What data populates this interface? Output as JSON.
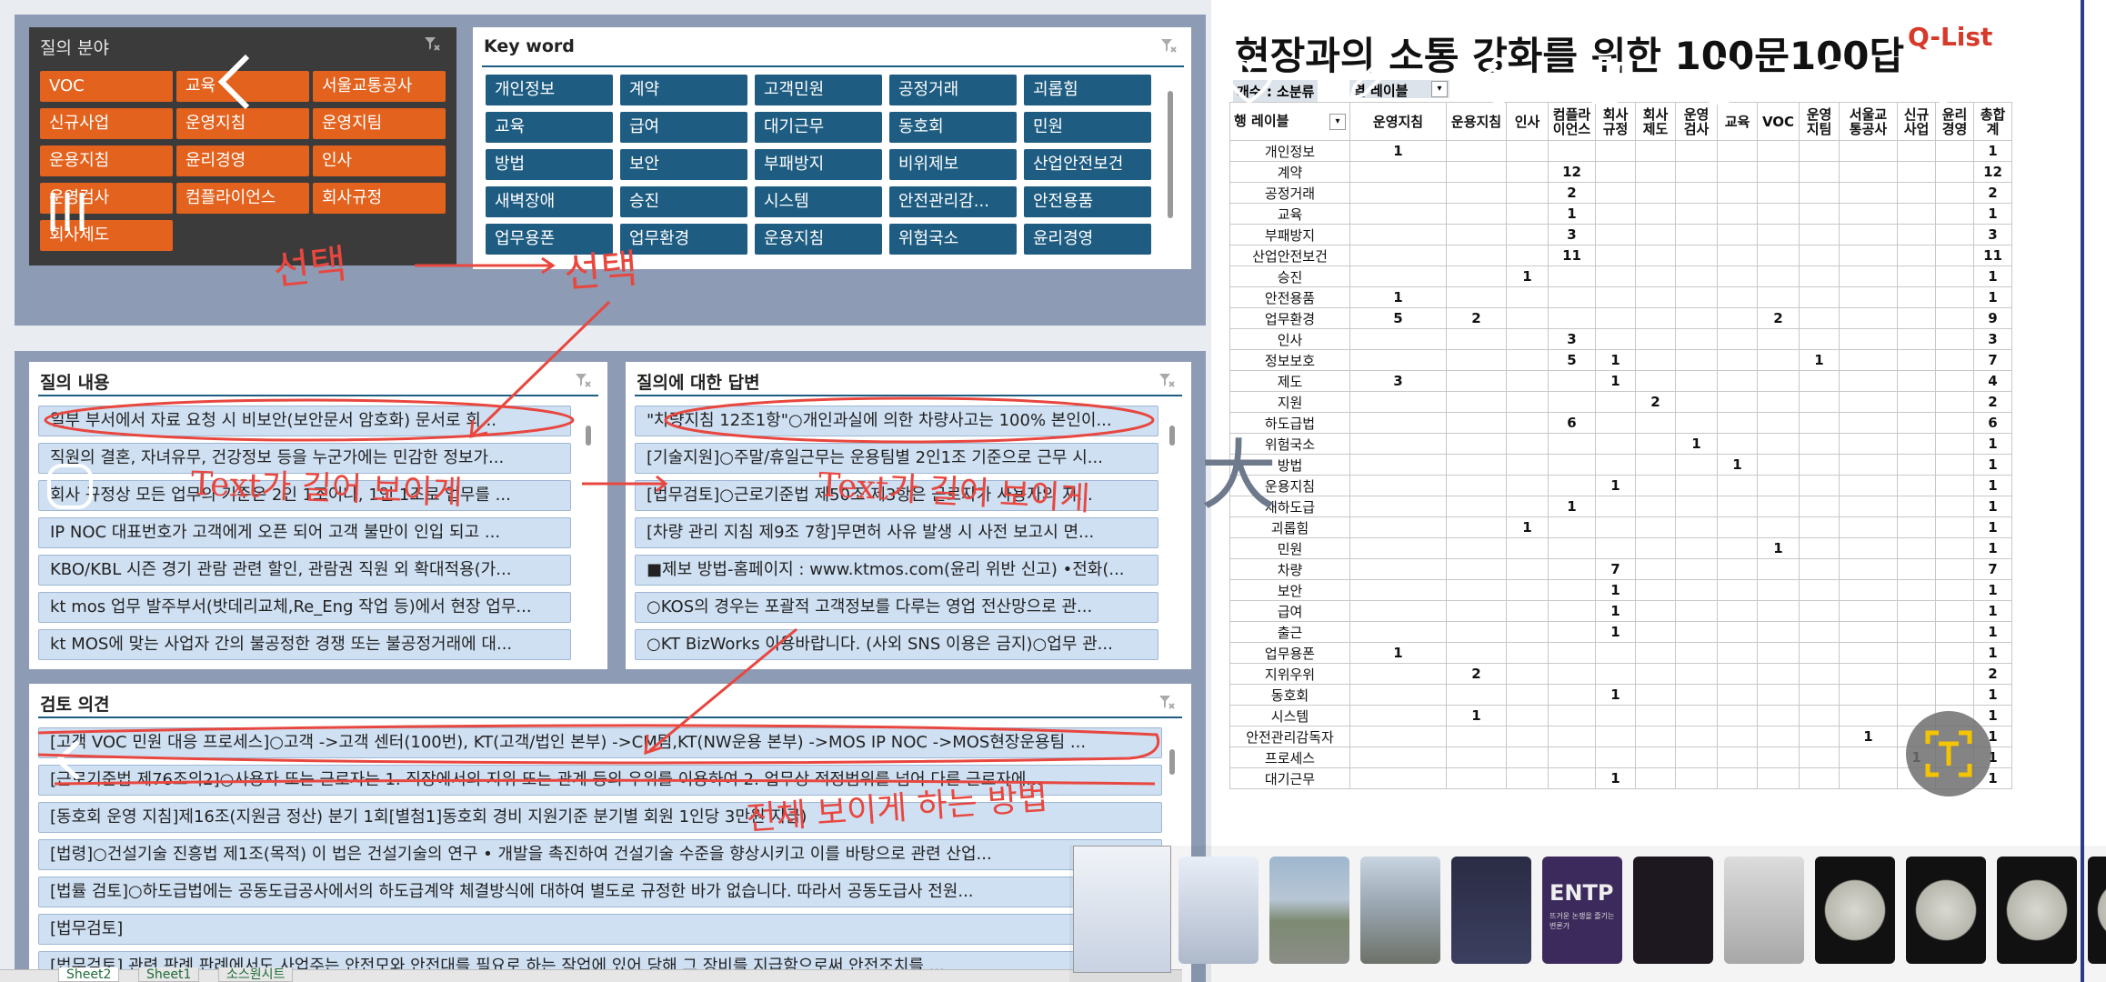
{
  "field_panel": {
    "title": "질의 분야",
    "items": [
      "VOC",
      "교육",
      "서울교통공사",
      "신규사업",
      "운영지침",
      "운영지팀",
      "운용지침",
      "윤리경영",
      "인사",
      "운영검사",
      "컴플라이언스",
      "회사규정",
      "회사제도"
    ]
  },
  "keyword_panel": {
    "title": "Key word",
    "items": [
      "개인정보",
      "계약",
      "고객민원",
      "공정거래",
      "괴롭힘",
      "교육",
      "급여",
      "대기근무",
      "동호회",
      "민원",
      "방법",
      "보안",
      "부패방지",
      "비위제보",
      "산업안전보건",
      "새벽장애",
      "승진",
      "시스템",
      "안전관리감...",
      "안전용품",
      "업무용폰",
      "업무환경",
      "운용지침",
      "위험국소",
      "윤리경영"
    ]
  },
  "question_panel": {
    "title": "질의 내용",
    "items": [
      "일부 부서에서 자료 요청 시 비보안(보안문서 암호화) 문서로 회...",
      "직원의 결혼, 자녀유무, 건강정보 등을 누군가에는 민감한 정보가...",
      "회사 규정상 모든 업무의 기준은 2인 1조이나, 1인 1조로 업무를 ...",
      "IP NOC 대표번호가 고객에게 오픈 되어 고객 불만이 인입 되고 ...",
      "KBO/KBL 시즌 경기 관람 관련 할인, 관람권 직원 외 확대적용(가...",
      "kt mos 업무 발주부서(밧데리교체,Re_Eng 작업 등)에서 현장 업무...",
      "kt MOS에 맞는 사업자 간의 불공정한 경쟁 또는 불공정거래에 대..."
    ]
  },
  "answer_panel": {
    "title": "질의에 대한 답변",
    "items": [
      "\"차량지침 12조1항\"○개인과실에 의한 차량사고는 100% 본인이...",
      "[기술지원]○주말/휴일근무는 운용팀별 2인1조 기준으로 근무 시...",
      "[법무검토]○근로기준법 제50조 제3항은 근로자가 사용자의 지...",
      "[차량 관리 지침 제9조 7항]무면허 사유 발생 시 사전 보고시 면...",
      "■제보 방법-홈페이지 : www.ktmos.com(윤리 위반 신고) •전화(...",
      "○KOS의 경우는 포괄적 고객정보를 다루는 영업 전산망으로 관...",
      "○KT BizWorks 이용바랍니다. (사외 SNS 이용은 금지)○업무 관..."
    ]
  },
  "review_panel": {
    "title": "검토 의견",
    "items": [
      "[고객 VOC 민원 대응 프로세스]○고객 ->고객 센터(100번), KT(고객/법인 본부) ->CM팀,KT(NW운용 본부) ->MOS IP NOC ->MOS현장운용팀 ...",
      "[근로기준법 제76조의2]○사용자 또는 근로자는 1. 직장에서의 지위 또는 관계 등의 우위를 이용하여 2. 업무상 적정범위를 넘어 다른 근로자에...",
      "[동호회 운영 지침]제16조(지원금 정산) 분기 1회[별첨1]동호회 경비 지원기준 분기별 회원 1인당 3만원 지급)",
      "[법령]○건설기술 진흥법 제1조(목적) 이 법은 건설기술의 연구 • 개발을 촉진하여 건설기술 수준을 향상시키고 이를 바탕으로 관련 산업...",
      "[법률 검토]○하도급법에는 공동도급공사에서의 하도급계약 체결방식에 대하여 별도로 규정한 바가 없습니다. 따라서 공동도급사 전원...",
      "[법무검토]",
      "[법무검토] 관련 판례 판례에서도 사업주는 안전모와 안전대를 필요로 하는 작업에 있어 당해 그 장비를 지급함으로써 안전조치를 ..."
    ]
  },
  "report": {
    "title": "현장과의 소통 강화를 위한 100문100답",
    "qlist": "Q-List",
    "filter1": "개수 : 소분류",
    "filter2": "열 레이블",
    "row_header": "행 레이블"
  },
  "columns": [
    "운영지침",
    "운용지침",
    "인사",
    "컴플라\n이언스",
    "회사\n규정",
    "회사\n제도",
    "운영\n검사",
    "교육",
    "VOC",
    "운영\n지팀",
    "서울교\n통공사",
    "신규\n사업",
    "윤리\n경영",
    "총합\n계"
  ],
  "rows": [
    [
      "개인정보",
      "1",
      "",
      "",
      "",
      "",
      "",
      "",
      "",
      "",
      "",
      "",
      "",
      "",
      "1"
    ],
    [
      "계약",
      "",
      "",
      "",
      "12",
      "",
      "",
      "",
      "",
      "",
      "",
      "",
      "",
      "",
      "12"
    ],
    [
      "공정거래",
      "",
      "",
      "",
      "2",
      "",
      "",
      "",
      "",
      "",
      "",
      "",
      "",
      "",
      "2"
    ],
    [
      "교육",
      "",
      "",
      "",
      "1",
      "",
      "",
      "",
      "",
      "",
      "",
      "",
      "",
      "",
      "1"
    ],
    [
      "부패방지",
      "",
      "",
      "",
      "3",
      "",
      "",
      "",
      "",
      "",
      "",
      "",
      "",
      "",
      "3"
    ],
    [
      "산업안전보건",
      "",
      "",
      "",
      "11",
      "",
      "",
      "",
      "",
      "",
      "",
      "",
      "",
      "",
      "11"
    ],
    [
      "승진",
      "",
      "",
      "1",
      "",
      "",
      "",
      "",
      "",
      "",
      "",
      "",
      "",
      "",
      "1"
    ],
    [
      "안전용품",
      "1",
      "",
      "",
      "",
      "",
      "",
      "",
      "",
      "",
      "",
      "",
      "",
      "",
      "1"
    ],
    [
      "업무환경",
      "5",
      "2",
      "",
      "",
      "",
      "",
      "",
      "",
      "2",
      "",
      "",
      "",
      "",
      "9"
    ],
    [
      "인사",
      "",
      "",
      "",
      "3",
      "",
      "",
      "",
      "",
      "",
      "",
      "",
      "",
      "",
      "3"
    ],
    [
      "정보보호",
      "",
      "",
      "",
      "5",
      "1",
      "",
      "",
      "",
      "",
      "1",
      "",
      "",
      "",
      "7"
    ],
    [
      "제도",
      "3",
      "",
      "",
      "",
      "1",
      "",
      "",
      "",
      "",
      "",
      "",
      "",
      "",
      "4"
    ],
    [
      "지원",
      "",
      "",
      "",
      "",
      "",
      "2",
      "",
      "",
      "",
      "",
      "",
      "",
      "",
      "2"
    ],
    [
      "하도급법",
      "",
      "",
      "",
      "6",
      "",
      "",
      "",
      "",
      "",
      "",
      "",
      "",
      "",
      "6"
    ],
    [
      "위험국소",
      "",
      "",
      "",
      "",
      "",
      "",
      "1",
      "",
      "",
      "",
      "",
      "",
      "",
      "1"
    ],
    [
      "방법",
      "",
      "",
      "",
      "",
      "",
      "",
      "",
      "1",
      "",
      "",
      "",
      "",
      "",
      "1"
    ],
    [
      "운용지침",
      "",
      "",
      "",
      "",
      "1",
      "",
      "",
      "",
      "",
      "",
      "",
      "",
      "",
      "1"
    ],
    [
      "재하도급",
      "",
      "",
      "",
      "1",
      "",
      "",
      "",
      "",
      "",
      "",
      "",
      "",
      "",
      "1"
    ],
    [
      "괴롭힘",
      "",
      "",
      "1",
      "",
      "",
      "",
      "",
      "",
      "",
      "",
      "",
      "",
      "",
      "1"
    ],
    [
      "민원",
      "",
      "",
      "",
      "",
      "",
      "",
      "",
      "",
      "1",
      "",
      "",
      "",
      "",
      "1"
    ],
    [
      "차량",
      "",
      "",
      "",
      "",
      "7",
      "",
      "",
      "",
      "",
      "",
      "",
      "",
      "",
      "7"
    ],
    [
      "보안",
      "",
      "",
      "",
      "",
      "1",
      "",
      "",
      "",
      "",
      "",
      "",
      "",
      "",
      "1"
    ],
    [
      "급여",
      "",
      "",
      "",
      "",
      "1",
      "",
      "",
      "",
      "",
      "",
      "",
      "",
      "",
      "1"
    ],
    [
      "출근",
      "",
      "",
      "",
      "",
      "1",
      "",
      "",
      "",
      "",
      "",
      "",
      "",
      "",
      "1"
    ],
    [
      "업무용폰",
      "1",
      "",
      "",
      "",
      "",
      "",
      "",
      "",
      "",
      "",
      "",
      "",
      "",
      "1"
    ],
    [
      "지위우위",
      "",
      "2",
      "",
      "",
      "",
      "",
      "",
      "",
      "",
      "",
      "",
      "",
      "",
      "2"
    ],
    [
      "동호회",
      "",
      "",
      "",
      "",
      "1",
      "",
      "",
      "",
      "",
      "",
      "",
      "",
      "",
      "1"
    ],
    [
      "시스템",
      "",
      "1",
      "",
      "",
      "",
      "",
      "",
      "",
      "",
      "",
      "",
      "",
      "",
      "1"
    ],
    [
      "안전관리감독자",
      "",
      "",
      "",
      "",
      "",
      "",
      "",
      "",
      "",
      "",
      "1",
      "",
      "",
      "1"
    ],
    [
      "프로세스",
      "",
      "",
      "",
      "",
      "",
      "",
      "",
      "",
      "",
      "",
      "",
      "1",
      "",
      "1"
    ],
    [
      "대기근무",
      "",
      "",
      "",
      "",
      "1",
      "",
      "",
      "",
      "",
      "",
      "",
      "",
      "",
      "1"
    ]
  ],
  "annotations": {
    "a1": "선택",
    "a2": "선택",
    "a3": "Text가 길어 보이게",
    "a4": "Text가 길어 보이게",
    "a5": "전체 보이게 하는 방법",
    "a6": "大"
  },
  "sheet_tabs": [
    "Sheet2",
    "Sheet1",
    "소스원시트"
  ],
  "thumbnails": [
    "doc",
    "city",
    "street",
    "chart",
    "ENTP",
    "dark",
    "paper",
    "moon",
    "moon",
    "moon",
    "moon"
  ],
  "thumb_entp": {
    "label": "ENTP",
    "sub": "뜨거운 논쟁을 즐기는 변론가"
  },
  "colors": {
    "orange": "#e2621e",
    "blue": "#1e5c82",
    "light_row": "#cfe0f3",
    "annotation": "#e8473f"
  }
}
